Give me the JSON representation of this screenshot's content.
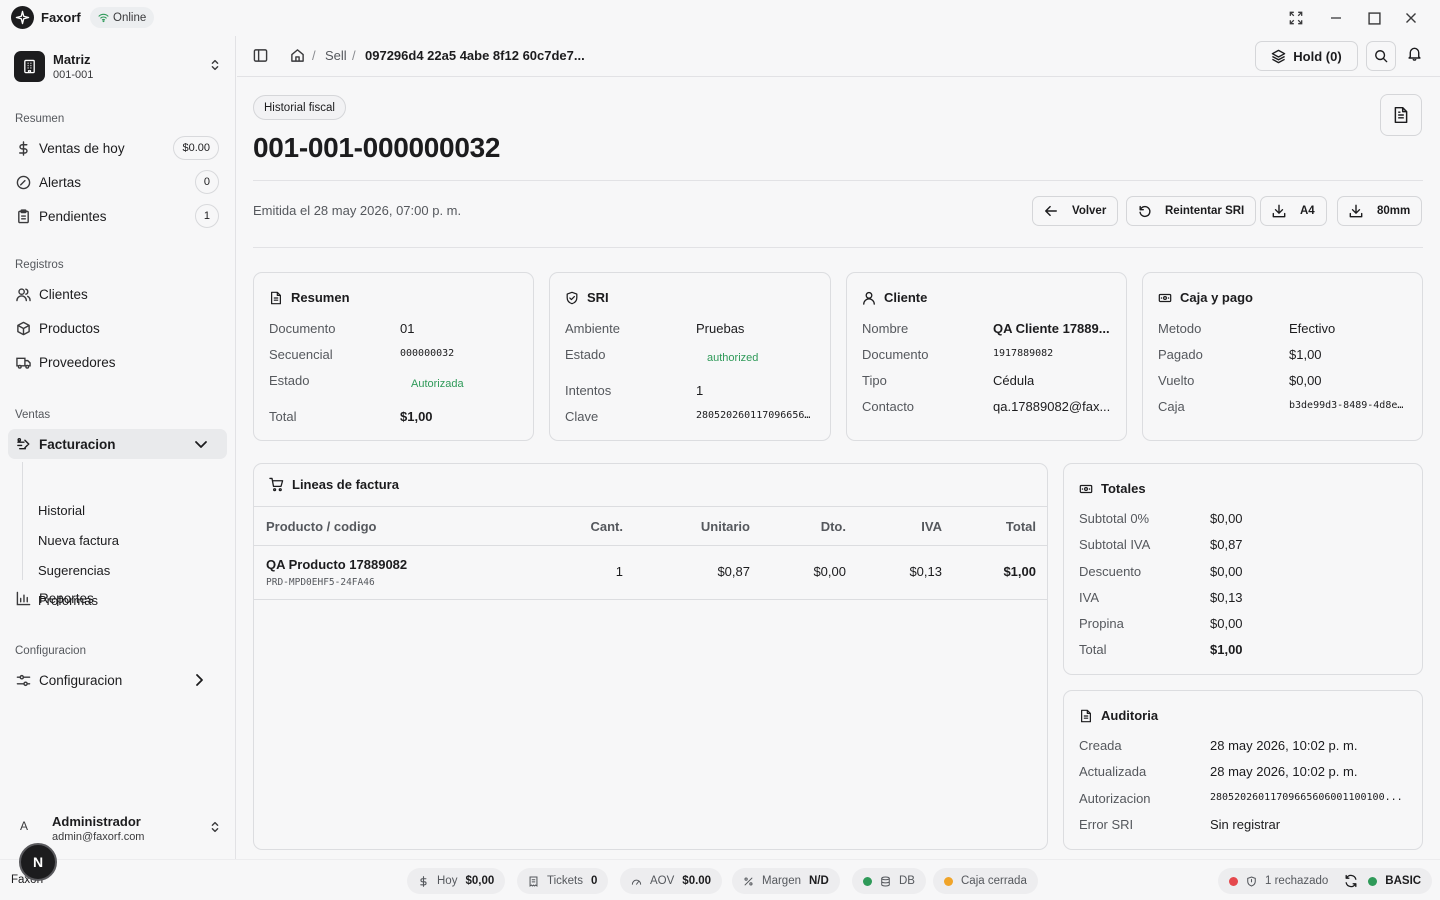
{
  "app": {
    "name": "Faxorf",
    "status": "Online"
  },
  "org": {
    "name": "Matriz",
    "code": "001-001"
  },
  "sidebar": {
    "sections": {
      "resumen": "Resumen",
      "registros": "Registros",
      "ventas": "Ventas",
      "configuracion": "Configuracion"
    },
    "resumen": [
      {
        "label": "Ventas de hoy",
        "badge": "$0.00"
      },
      {
        "label": "Alertas",
        "badge": "0"
      },
      {
        "label": "Pendientes",
        "badge": "1"
      }
    ],
    "registros": [
      {
        "label": "Clientes"
      },
      {
        "label": "Productos"
      },
      {
        "label": "Proveedores"
      }
    ],
    "facturacion": {
      "label": "Facturacion",
      "children": [
        "Historial",
        "Nueva factura",
        "Sugerencias",
        "Proformas"
      ]
    },
    "reportes": "Reportes",
    "config": "Configuracion"
  },
  "user": {
    "avatar": "A",
    "name": "Administrador",
    "email": "admin@faxorf.com",
    "fab": "N",
    "footer_label": "Faxorf"
  },
  "header": {
    "breadcrumb_sell": "Sell",
    "breadcrumb_id": "097296d4 22a5 4abe 8f12 60c7de7...",
    "separator": "/",
    "hold": "Hold (0)"
  },
  "document": {
    "chip": "Historial fiscal",
    "title": "001-001-000000032",
    "issued": "Emitida el 28 may 2026, 07:00 p. m.",
    "actions": {
      "back": "Volver",
      "retry": "Reintentar SRI",
      "a4": "A4",
      "mm80": "80mm"
    }
  },
  "cards": {
    "resumen": {
      "title": "Resumen",
      "rows": [
        {
          "k": "Documento",
          "v": "01"
        },
        {
          "k": "Secuencial",
          "v": "000000032"
        },
        {
          "k": "Estado",
          "v": "Autorizada"
        },
        {
          "k": "Total",
          "v": "$1,00"
        }
      ]
    },
    "sri": {
      "title": "SRI",
      "rows": [
        {
          "k": "Ambiente",
          "v": "Pruebas"
        },
        {
          "k": "Estado",
          "v": "authorized"
        },
        {
          "k": "Intentos",
          "v": "1"
        },
        {
          "k": "Clave",
          "v": "280520260117096656..."
        }
      ]
    },
    "cliente": {
      "title": "Cliente",
      "rows": [
        {
          "k": "Nombre",
          "v": "QA Cliente 17889..."
        },
        {
          "k": "Documento",
          "v": "1917889082"
        },
        {
          "k": "Tipo",
          "v": "Cédula"
        },
        {
          "k": "Contacto",
          "v": "qa.17889082@fax..."
        }
      ]
    },
    "caja": {
      "title": "Caja y pago",
      "rows": [
        {
          "k": "Metodo",
          "v": "Efectivo"
        },
        {
          "k": "Pagado",
          "v": "$1,00"
        },
        {
          "k": "Vuelto",
          "v": "$0,00"
        },
        {
          "k": "Caja",
          "v": "b3de99d3-8489-4d8e..."
        }
      ]
    }
  },
  "lines": {
    "title": "Lineas de factura",
    "headers": [
      "Producto / codigo",
      "Cant.",
      "Unitario",
      "Dto.",
      "IVA",
      "Total"
    ],
    "rows": [
      {
        "product": "QA Producto 17889082",
        "code": "PRD-MPD0EHF5-24FA46",
        "qty": "1",
        "unit": "$0,87",
        "disc": "$0,00",
        "iva": "$0,13",
        "total": "$1,00"
      }
    ]
  },
  "totales": {
    "title": "Totales",
    "rows": [
      {
        "k": "Subtotal 0%",
        "v": "$0,00"
      },
      {
        "k": "Subtotal IVA",
        "v": "$0,87"
      },
      {
        "k": "Descuento",
        "v": "$0,00"
      },
      {
        "k": "IVA",
        "v": "$0,13"
      },
      {
        "k": "Propina",
        "v": "$0,00"
      },
      {
        "k": "Total",
        "v": "$1,00"
      }
    ]
  },
  "auditoria": {
    "title": "Auditoria",
    "rows": [
      {
        "k": "Creada",
        "v": "28 may 2026, 10:02 p. m."
      },
      {
        "k": "Actualizada",
        "v": "28 may 2026, 10:02 p. m."
      },
      {
        "k": "Autorizacion",
        "v": "28052026011709665606001100100..."
      },
      {
        "k": "Error SRI",
        "v": "Sin registrar"
      }
    ]
  },
  "statusbar": {
    "hoy_label": "Hoy",
    "hoy_value": "$0,00",
    "tickets_label": "Tickets",
    "tickets_value": "0",
    "aov_label": "AOV",
    "aov_value": "$0.00",
    "margen_label": "Margen",
    "margen_value": "N/D",
    "db": "DB",
    "caja": "Caja cerrada",
    "rechazado": "1 rechazado",
    "plan": "BASIC"
  },
  "colors": {
    "success": "#2f9a59",
    "warning": "#f0a429",
    "danger": "#e5484d",
    "primary": "#1c1c1e"
  }
}
